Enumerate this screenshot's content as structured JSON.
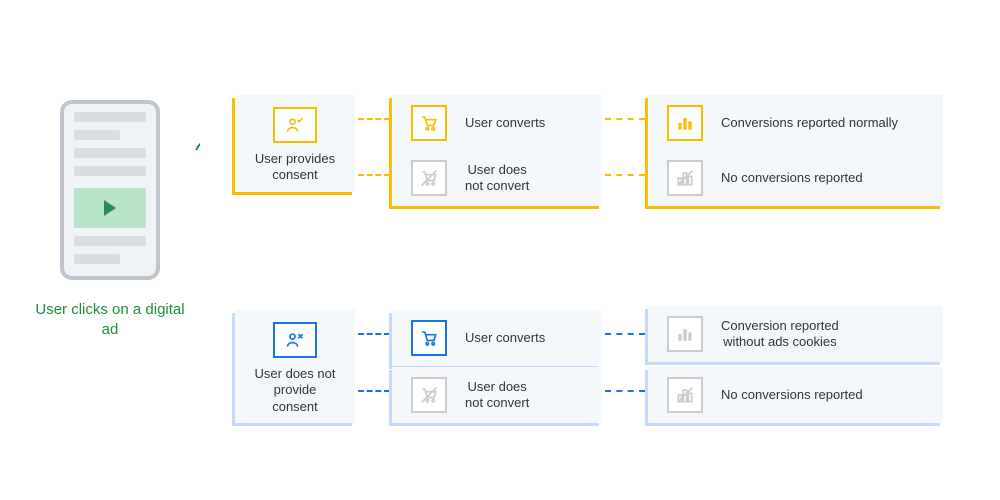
{
  "start": {
    "caption": "User clicks on a digital ad"
  },
  "consent": {
    "yes": {
      "label": "User provides consent"
    },
    "no": {
      "label": "User does not provide consent"
    }
  },
  "convert": {
    "yes": "User converts",
    "no": "User does\nnot convert"
  },
  "outcome": {
    "reported_normal": "Conversions reported normally",
    "not_reported": "No conversions reported",
    "reported_no_cookies": "Conversion reported\nwithout ads cookies"
  }
}
